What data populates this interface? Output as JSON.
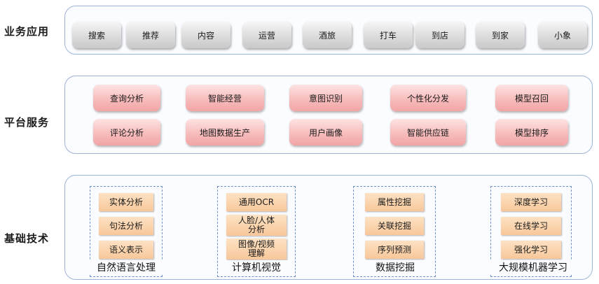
{
  "rows": {
    "business": "业务应用",
    "platform": "平台服务",
    "foundation": "基础技术"
  },
  "business_items": [
    "搜索",
    "推荐",
    "内容",
    "运营",
    "酒旅",
    "打车",
    "到店",
    "到家",
    "小象"
  ],
  "platform_items": {
    "top": [
      "查询分析",
      "智能经营",
      "意图识别",
      "个性化分发",
      "模型召回"
    ],
    "bottom": [
      "评论分析",
      "地图数据生产",
      "用户画像",
      "智能供应链",
      "模型排序"
    ]
  },
  "foundation_groups": [
    {
      "title": "自然语言处理",
      "items": [
        "实体分析",
        "句法分析",
        "语义表示"
      ]
    },
    {
      "title": "计算机视觉",
      "items": [
        "通用OCR",
        "人脸/人体分析",
        "图像/视频理解"
      ]
    },
    {
      "title": "数据挖掘",
      "items": [
        "属性挖掘",
        "关联挖掘",
        "序列预测"
      ]
    },
    {
      "title": "大规模机器学习",
      "items": [
        "深度学习",
        "在线学习",
        "强化学习"
      ]
    }
  ]
}
